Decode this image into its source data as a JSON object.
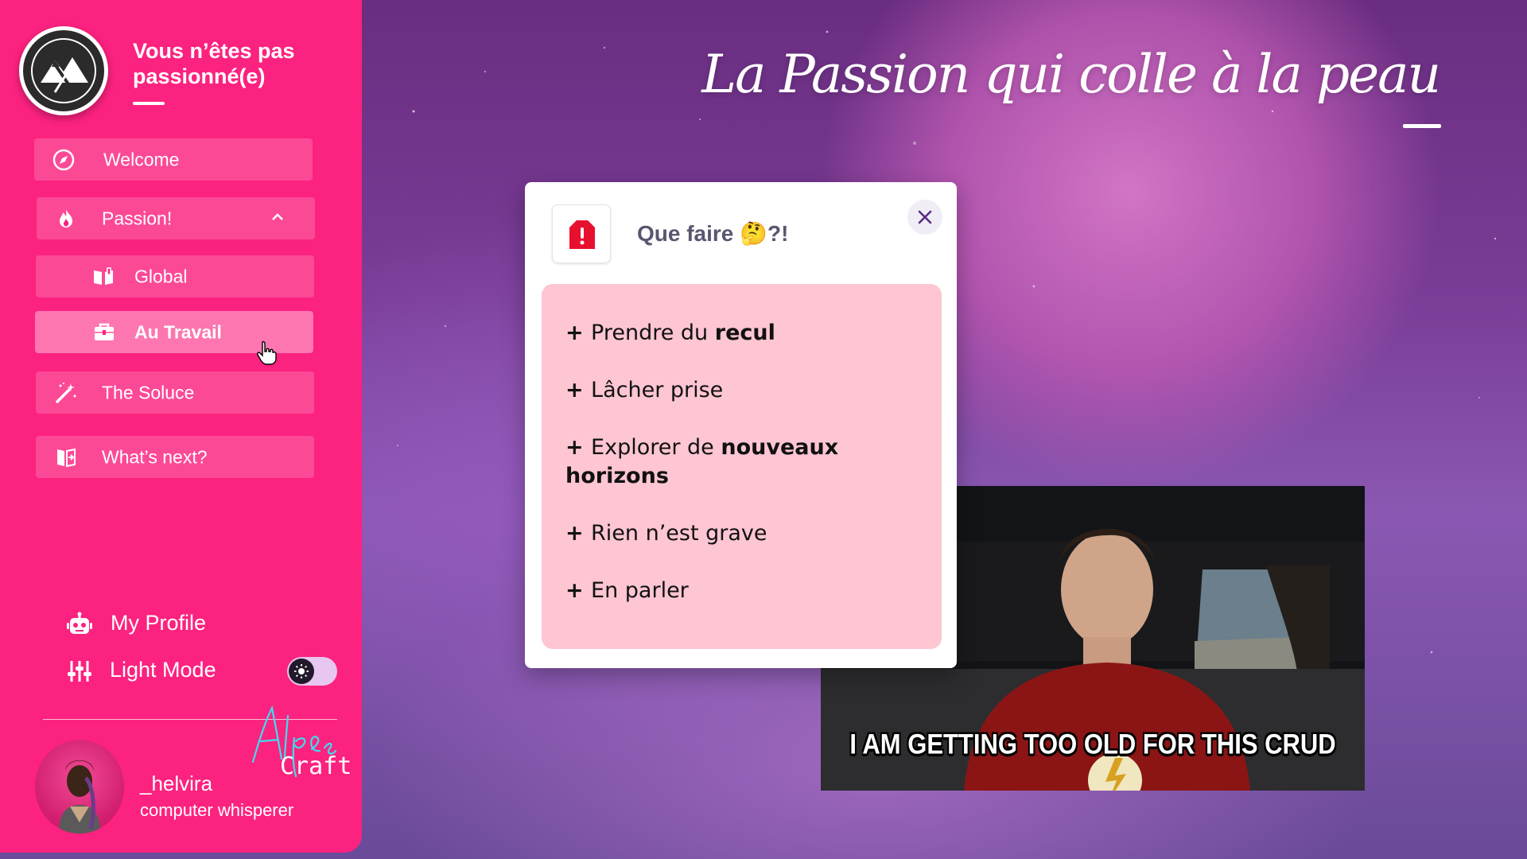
{
  "sidebar": {
    "brand_title": "Vous n’êtes pas passionné(e)",
    "nav": {
      "welcome": "Welcome",
      "passion": "Passion!",
      "global": "Global",
      "au_travail": "Au Travail",
      "the_soluce": "The Soluce",
      "whats_next": "What’s next?"
    },
    "my_profile": "My Profile",
    "light_mode": "Light Mode",
    "user": {
      "name": "_helvira",
      "role": "computer whisperer"
    },
    "signature": "Alpes Craft"
  },
  "header": {
    "headline": "La Passion qui colle à la peau"
  },
  "modal": {
    "title": "Que faire 🤔?!",
    "tips": [
      {
        "prefix": "+ ",
        "text": "Prendre du ",
        "bold": "recul"
      },
      {
        "prefix": "+ ",
        "text": "Lâcher prise",
        "bold": ""
      },
      {
        "prefix": "+ ",
        "text": "Explorer de ",
        "bold": "nouveaux horizons"
      },
      {
        "prefix": "+ ",
        "text": "Rien n’est grave",
        "bold": ""
      },
      {
        "prefix": "+ ",
        "text": "En parler",
        "bold": ""
      }
    ]
  },
  "video": {
    "subtitle": "I AM GETTING TOO OLD FOR THIS CRUD"
  },
  "colors": {
    "sidebar_bg": "#fc227f",
    "modal_panel": "#fec5d2",
    "alert_red": "#e8102f",
    "close_x": "#5a2a82"
  }
}
